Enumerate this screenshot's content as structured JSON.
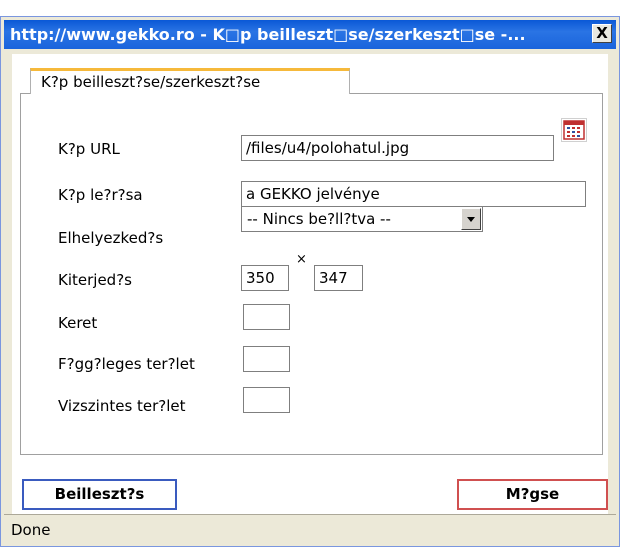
{
  "window": {
    "title": "http://www.gekko.ro - K□p beilleszt□se/szerkeszt□se -...",
    "close_label": "X"
  },
  "tab": {
    "label": "K?p beilleszt?se/szerkeszt?se"
  },
  "form": {
    "url": {
      "label": "K?p URL",
      "value": "/files/u4/polohatul.jpg"
    },
    "description": {
      "label": "K?p le?r?sa",
      "value": "a GEKKO jelvénye"
    },
    "alignment": {
      "label": "Elhelyezked?s",
      "selected": "-- Nincs be?ll?tva --"
    },
    "dimensions": {
      "label": "Kiterjed?s",
      "width": "350",
      "separator": "×",
      "height": "347"
    },
    "border": {
      "label": "Keret",
      "value": ""
    },
    "vspace": {
      "label": "F?gg?leges ter?let",
      "value": ""
    },
    "hspace": {
      "label": "Vizszintes ter?let",
      "value": ""
    }
  },
  "buttons": {
    "insert_label": "Beilleszt?s",
    "cancel_label": "M?gse"
  },
  "status": {
    "text": "Done"
  },
  "colors": {
    "title_bar": "#0a58d6",
    "tab_accent": "#f6b93b",
    "insert_border": "#3a5bbf",
    "cancel_border": "#d05050"
  },
  "icons": {
    "browse": "calendar-grid-icon"
  }
}
